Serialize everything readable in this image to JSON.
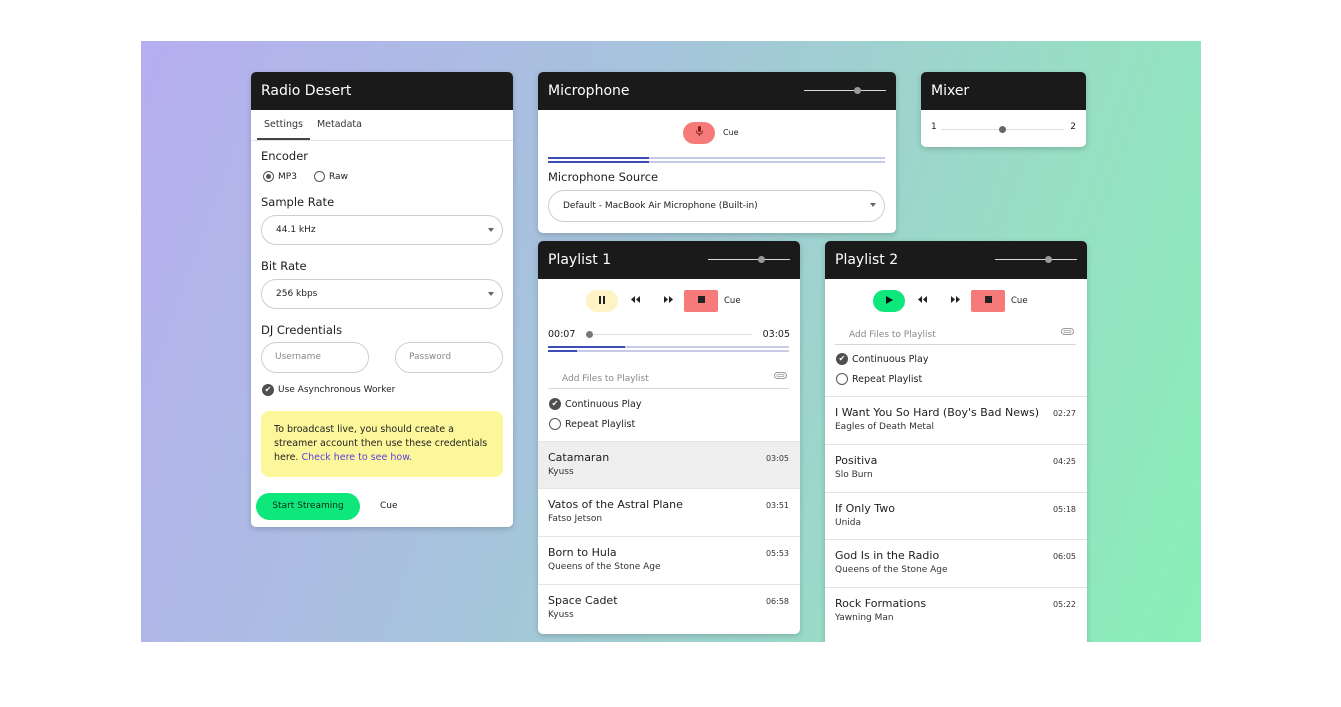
{
  "radio": {
    "title": "Radio Desert",
    "tabs": [
      "Settings",
      "Metadata"
    ],
    "encoder_label": "Encoder",
    "encoder_options": [
      "MP3",
      "Raw"
    ],
    "encoder_selected": "MP3",
    "sample_rate_label": "Sample Rate",
    "sample_rate_value": "44.1 kHz",
    "bit_rate_label": "Bit Rate",
    "bit_rate_value": "256 kbps",
    "credentials_label": "DJ Credentials",
    "username_placeholder": "Username",
    "password_placeholder": "Password",
    "async_label": "Use Asynchronous Worker",
    "notice_text": "To broadcast live, you should create a streamer account then use these credentials here.",
    "notice_link": "Check here to see how.",
    "start_label": "Start Streaming",
    "cue_label": "Cue"
  },
  "microphone": {
    "title": "Microphone",
    "cue_label": "Cue",
    "source_label": "Microphone Source",
    "source_value": "Default - MacBook Air Microphone (Built-in)",
    "level": 0.3
  },
  "mixer": {
    "title": "Mixer",
    "left_label": "1",
    "right_label": "2",
    "position": 0.5
  },
  "playlist1": {
    "title": "Playlist 1",
    "cue_label": "Cue",
    "elapsed": "00:07",
    "duration": "03:05",
    "add_files_placeholder": "Add Files to Playlist",
    "continuous_play": "Continuous Play",
    "repeat_playlist": "Repeat Playlist",
    "tracks": [
      {
        "title": "Catamaran",
        "artist": "Kyuss",
        "duration": "03:05"
      },
      {
        "title": "Vatos of the Astral Plane",
        "artist": "Fatso Jetson",
        "duration": "03:51"
      },
      {
        "title": "Born to Hula",
        "artist": "Queens of the Stone Age",
        "duration": "05:53"
      },
      {
        "title": "Space Cadet",
        "artist": "Kyuss",
        "duration": "06:58"
      }
    ]
  },
  "playlist2": {
    "title": "Playlist 2",
    "cue_label": "Cue",
    "add_files_placeholder": "Add Files to Playlist",
    "continuous_play": "Continuous Play",
    "repeat_playlist": "Repeat Playlist",
    "tracks": [
      {
        "title": "I Want You So Hard (Boy's Bad News)",
        "artist": "Eagles of Death Metal",
        "duration": "02:27"
      },
      {
        "title": "Positiva",
        "artist": "Slo Burn",
        "duration": "04:25"
      },
      {
        "title": "If Only Two",
        "artist": "Unida",
        "duration": "05:18"
      },
      {
        "title": "God Is in the Radio",
        "artist": "Queens of the Stone Age",
        "duration": "06:05"
      },
      {
        "title": "Rock Formations",
        "artist": "Yawning Man",
        "duration": "05:22"
      }
    ]
  },
  "colors": {
    "header": "#1a1a1a",
    "accent_green": "#0ee77b",
    "stop_red": "#f77a7a",
    "pause_yellow": "#fdf3c5",
    "notice_yellow": "#fdf79b",
    "link_purple": "#5a3ee0",
    "progress_blue": "#3d4db8"
  }
}
